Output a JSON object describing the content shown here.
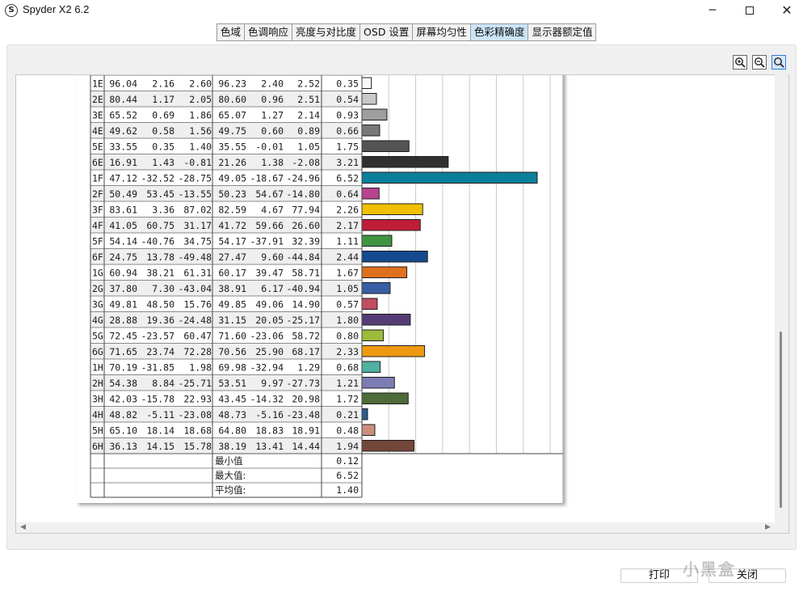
{
  "window": {
    "title": "Spyder X2 6.2",
    "icon": "spyder-s-logo-icon",
    "minimize": "─",
    "close": "✕"
  },
  "tabs": [
    {
      "label": "色域",
      "active": false
    },
    {
      "label": "色调响应",
      "active": false
    },
    {
      "label": "亮度与对比度",
      "active": false
    },
    {
      "label": "OSD 设置",
      "active": false
    },
    {
      "label": "屏幕均匀性",
      "active": false
    },
    {
      "label": "色彩精确度",
      "active": true
    },
    {
      "label": "显示器额定值",
      "active": false
    }
  ],
  "zoom_tools": [
    "zoom-in-icon",
    "zoom-out-icon",
    "zoom-fit-icon"
  ],
  "report": {
    "rows": [
      {
        "patch": "1E",
        "ref": [
          "96.04",
          "2.16",
          "2.60"
        ],
        "meas": [
          "96.23",
          "2.40",
          "2.52"
        ],
        "de": "0.35",
        "color": "#f8f8f8"
      },
      {
        "patch": "2E",
        "ref": [
          "80.44",
          "1.17",
          "2.05"
        ],
        "meas": [
          "80.60",
          "0.96",
          "2.51"
        ],
        "de": "0.54",
        "color": "#c8c8c8"
      },
      {
        "patch": "3E",
        "ref": [
          "65.52",
          "0.69",
          "1.86"
        ],
        "meas": [
          "65.07",
          "1.27",
          "2.14"
        ],
        "de": "0.93",
        "color": "#9e9e9e"
      },
      {
        "patch": "4E",
        "ref": [
          "49.62",
          "0.58",
          "1.56"
        ],
        "meas": [
          "49.75",
          "0.60",
          "0.89"
        ],
        "de": "0.66",
        "color": "#787878"
      },
      {
        "patch": "5E",
        "ref": [
          "33.55",
          "0.35",
          "1.40"
        ],
        "meas": [
          "35.55",
          "-0.01",
          "1.05"
        ],
        "de": "1.75",
        "color": "#545454"
      },
      {
        "patch": "6E",
        "ref": [
          "16.91",
          "1.43",
          "-0.81"
        ],
        "meas": [
          "21.26",
          "1.38",
          "-2.08"
        ],
        "de": "3.21",
        "color": "#303030"
      },
      {
        "patch": "1F",
        "ref": [
          "47.12",
          "-32.52",
          "-28.75"
        ],
        "meas": [
          "49.05",
          "-18.67",
          "-24.96"
        ],
        "de": "6.52",
        "color": "#0b7f9a"
      },
      {
        "patch": "2F",
        "ref": [
          "50.49",
          "53.45",
          "-13.55"
        ],
        "meas": [
          "50.23",
          "54.67",
          "-14.80"
        ],
        "de": "0.64",
        "color": "#b9438f"
      },
      {
        "patch": "3F",
        "ref": [
          "83.61",
          "3.36",
          "87.02"
        ],
        "meas": [
          "82.59",
          "4.67",
          "77.94"
        ],
        "de": "2.26",
        "color": "#f1c000"
      },
      {
        "patch": "4F",
        "ref": [
          "41.05",
          "60.75",
          "31.17"
        ],
        "meas": [
          "41.72",
          "59.66",
          "26.60"
        ],
        "de": "2.17",
        "color": "#bf1e38"
      },
      {
        "patch": "5F",
        "ref": [
          "54.14",
          "-40.76",
          "34.75"
        ],
        "meas": [
          "54.17",
          "-37.91",
          "32.39"
        ],
        "de": "1.11",
        "color": "#3f9442"
      },
      {
        "patch": "6F",
        "ref": [
          "24.75",
          "13.78",
          "-49.48"
        ],
        "meas": [
          "27.47",
          "9.60",
          "-44.84"
        ],
        "de": "2.44",
        "color": "#154a8f"
      },
      {
        "patch": "1G",
        "ref": [
          "60.94",
          "38.21",
          "61.31"
        ],
        "meas": [
          "60.17",
          "39.47",
          "58.71"
        ],
        "de": "1.67",
        "color": "#e0701f"
      },
      {
        "patch": "2G",
        "ref": [
          "37.80",
          "7.30",
          "-43.04"
        ],
        "meas": [
          "38.91",
          "6.17",
          "-40.94"
        ],
        "de": "1.05",
        "color": "#3a5ca2"
      },
      {
        "patch": "3G",
        "ref": [
          "49.81",
          "48.50",
          "15.76"
        ],
        "meas": [
          "49.85",
          "49.06",
          "14.90"
        ],
        "de": "0.57",
        "color": "#c24d5e"
      },
      {
        "patch": "4G",
        "ref": [
          "28.88",
          "19.36",
          "-24.48"
        ],
        "meas": [
          "31.15",
          "20.05",
          "-25.17"
        ],
        "de": "1.80",
        "color": "#543d74"
      },
      {
        "patch": "5G",
        "ref": [
          "72.45",
          "-23.57",
          "60.47"
        ],
        "meas": [
          "71.60",
          "-23.06",
          "58.72"
        ],
        "de": "0.80",
        "color": "#9bbb3a"
      },
      {
        "patch": "6G",
        "ref": [
          "71.65",
          "23.74",
          "72.28"
        ],
        "meas": [
          "70.56",
          "25.90",
          "68.17"
        ],
        "de": "2.33",
        "color": "#ed9a12"
      },
      {
        "patch": "1H",
        "ref": [
          "70.19",
          "-31.85",
          "1.98"
        ],
        "meas": [
          "69.98",
          "-32.94",
          "1.29"
        ],
        "de": "0.68",
        "color": "#4fb1a1"
      },
      {
        "patch": "2H",
        "ref": [
          "54.38",
          "8.84",
          "-25.71"
        ],
        "meas": [
          "53.51",
          "9.97",
          "-27.73"
        ],
        "de": "1.21",
        "color": "#7c7db5"
      },
      {
        "patch": "3H",
        "ref": [
          "42.03",
          "-15.78",
          "22.93"
        ],
        "meas": [
          "43.45",
          "-14.32",
          "20.98"
        ],
        "de": "1.72",
        "color": "#4e6b3a"
      },
      {
        "patch": "4H",
        "ref": [
          "48.82",
          "-5.11",
          "-23.08"
        ],
        "meas": [
          "48.73",
          "-5.16",
          "-23.48"
        ],
        "de": "0.21",
        "color": "#2f5b8f"
      },
      {
        "patch": "5H",
        "ref": [
          "65.10",
          "18.14",
          "18.68"
        ],
        "meas": [
          "64.80",
          "18.83",
          "18.91"
        ],
        "de": "0.48",
        "color": "#c98f7c"
      },
      {
        "patch": "6H",
        "ref": [
          "36.13",
          "14.15",
          "15.78"
        ],
        "meas": [
          "38.19",
          "13.41",
          "14.44"
        ],
        "de": "1.94",
        "color": "#74473b"
      }
    ],
    "summary": [
      {
        "label": "最小值",
        "value": "0.12"
      },
      {
        "label": "最大值:",
        "value": "6.52"
      },
      {
        "label": "平均值:",
        "value": "1.40"
      }
    ]
  },
  "chart_data": {
    "type": "bar",
    "title": "",
    "xlabel": "",
    "ylabel": "",
    "categories": [
      "1E",
      "2E",
      "3E",
      "4E",
      "5E",
      "6E",
      "1F",
      "2F",
      "3F",
      "4F",
      "5F",
      "6F",
      "1G",
      "2G",
      "3G",
      "4G",
      "5G",
      "6G",
      "1H",
      "2H",
      "3H",
      "4H",
      "5H",
      "6H"
    ],
    "values": [
      0.35,
      0.54,
      0.93,
      0.66,
      1.75,
      3.21,
      6.52,
      0.64,
      2.26,
      2.17,
      1.11,
      2.44,
      1.67,
      1.05,
      0.57,
      1.8,
      0.8,
      2.33,
      0.68,
      1.21,
      1.72,
      0.21,
      0.48,
      1.94
    ],
    "xlim": [
      0,
      8
    ],
    "orientation": "horizontal",
    "grid": true
  },
  "buttons": {
    "print": "打印",
    "close": "关闭"
  },
  "watermark": "小黑盒"
}
